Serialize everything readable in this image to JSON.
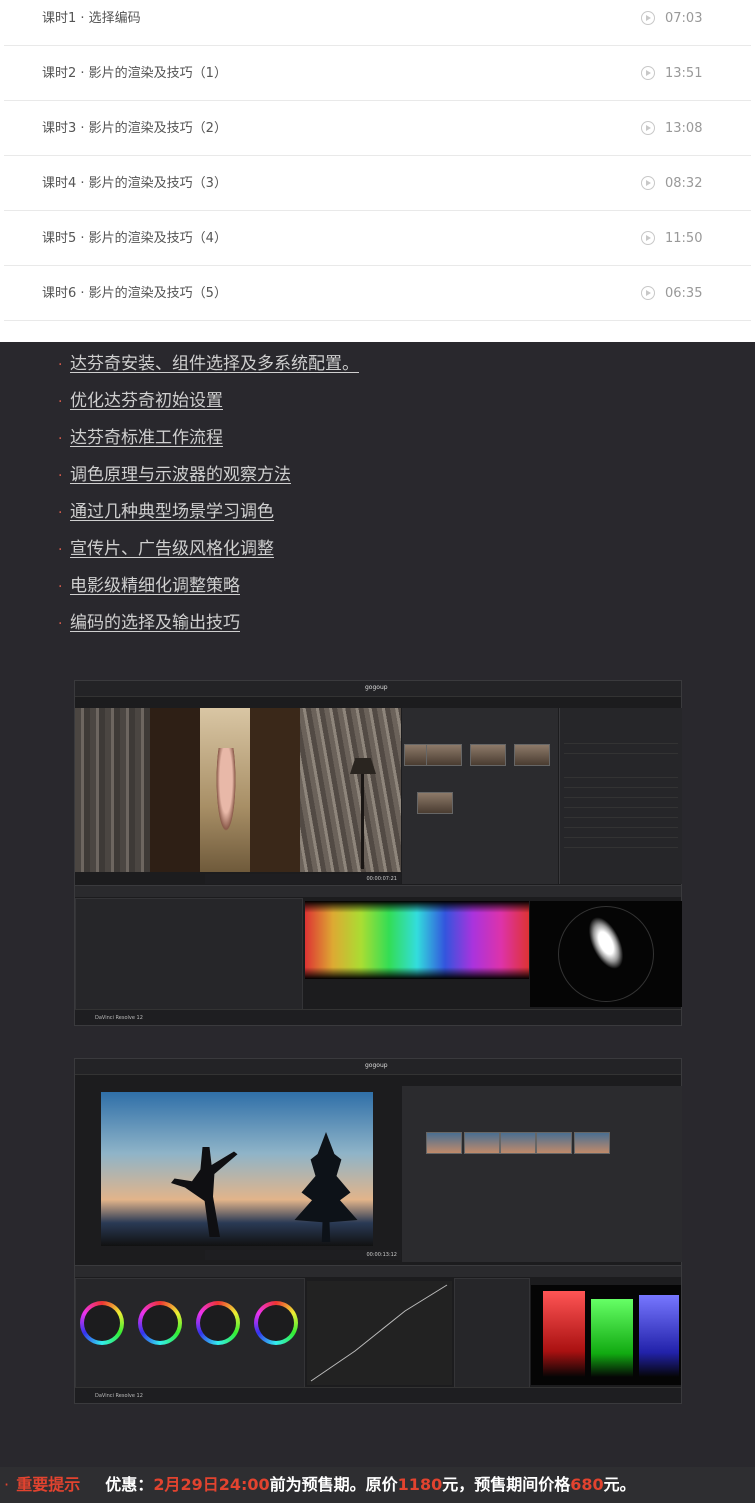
{
  "lessons": [
    {
      "title": "课时1 · 选择编码",
      "duration": "07:03"
    },
    {
      "title": "课时2 · 影片的渲染及技巧（1）",
      "duration": "13:51"
    },
    {
      "title": "课时3 · 影片的渲染及技巧（2）",
      "duration": "13:08"
    },
    {
      "title": "课时4 · 影片的渲染及技巧（3）",
      "duration": "08:32"
    },
    {
      "title": "课时5 · 影片的渲染及技巧（4）",
      "duration": "11:50"
    },
    {
      "title": "课时6 · 影片的渲染及技巧（5）",
      "duration": "06:35"
    }
  ],
  "topics": [
    "达芬奇安装、组件选择及多系统配置。",
    "优化达芬奇初始设置",
    "达芬奇标准工作流程",
    "调色原理与示波器的观察方法",
    "通过几种典型场景学习调色",
    "宣传片、广告级风格化调整",
    "电影级精细化调整策略",
    "编码的选择及输出技巧"
  ],
  "screenshots": {
    "shot1": {
      "project": "gogoup",
      "timecode": "00:00:07:21",
      "brand": "DaVinci Resolve 12"
    },
    "shot2": {
      "project": "gogoup",
      "timecode": "00:00:13:12",
      "brand": "DaVinci Resolve 12"
    }
  },
  "notice": {
    "bullet": "·",
    "label": "重要提示",
    "offer_prefix": "优惠：",
    "deadline": "2月29日24:00",
    "mid1": "前为预售期。原价",
    "original_price": "1180",
    "mid2": "元，预售期间价格",
    "presale_price": "680",
    "suffix": "元。"
  },
  "colors": {
    "accent_red": "#e2432f",
    "dark_bg": "#29282d"
  }
}
